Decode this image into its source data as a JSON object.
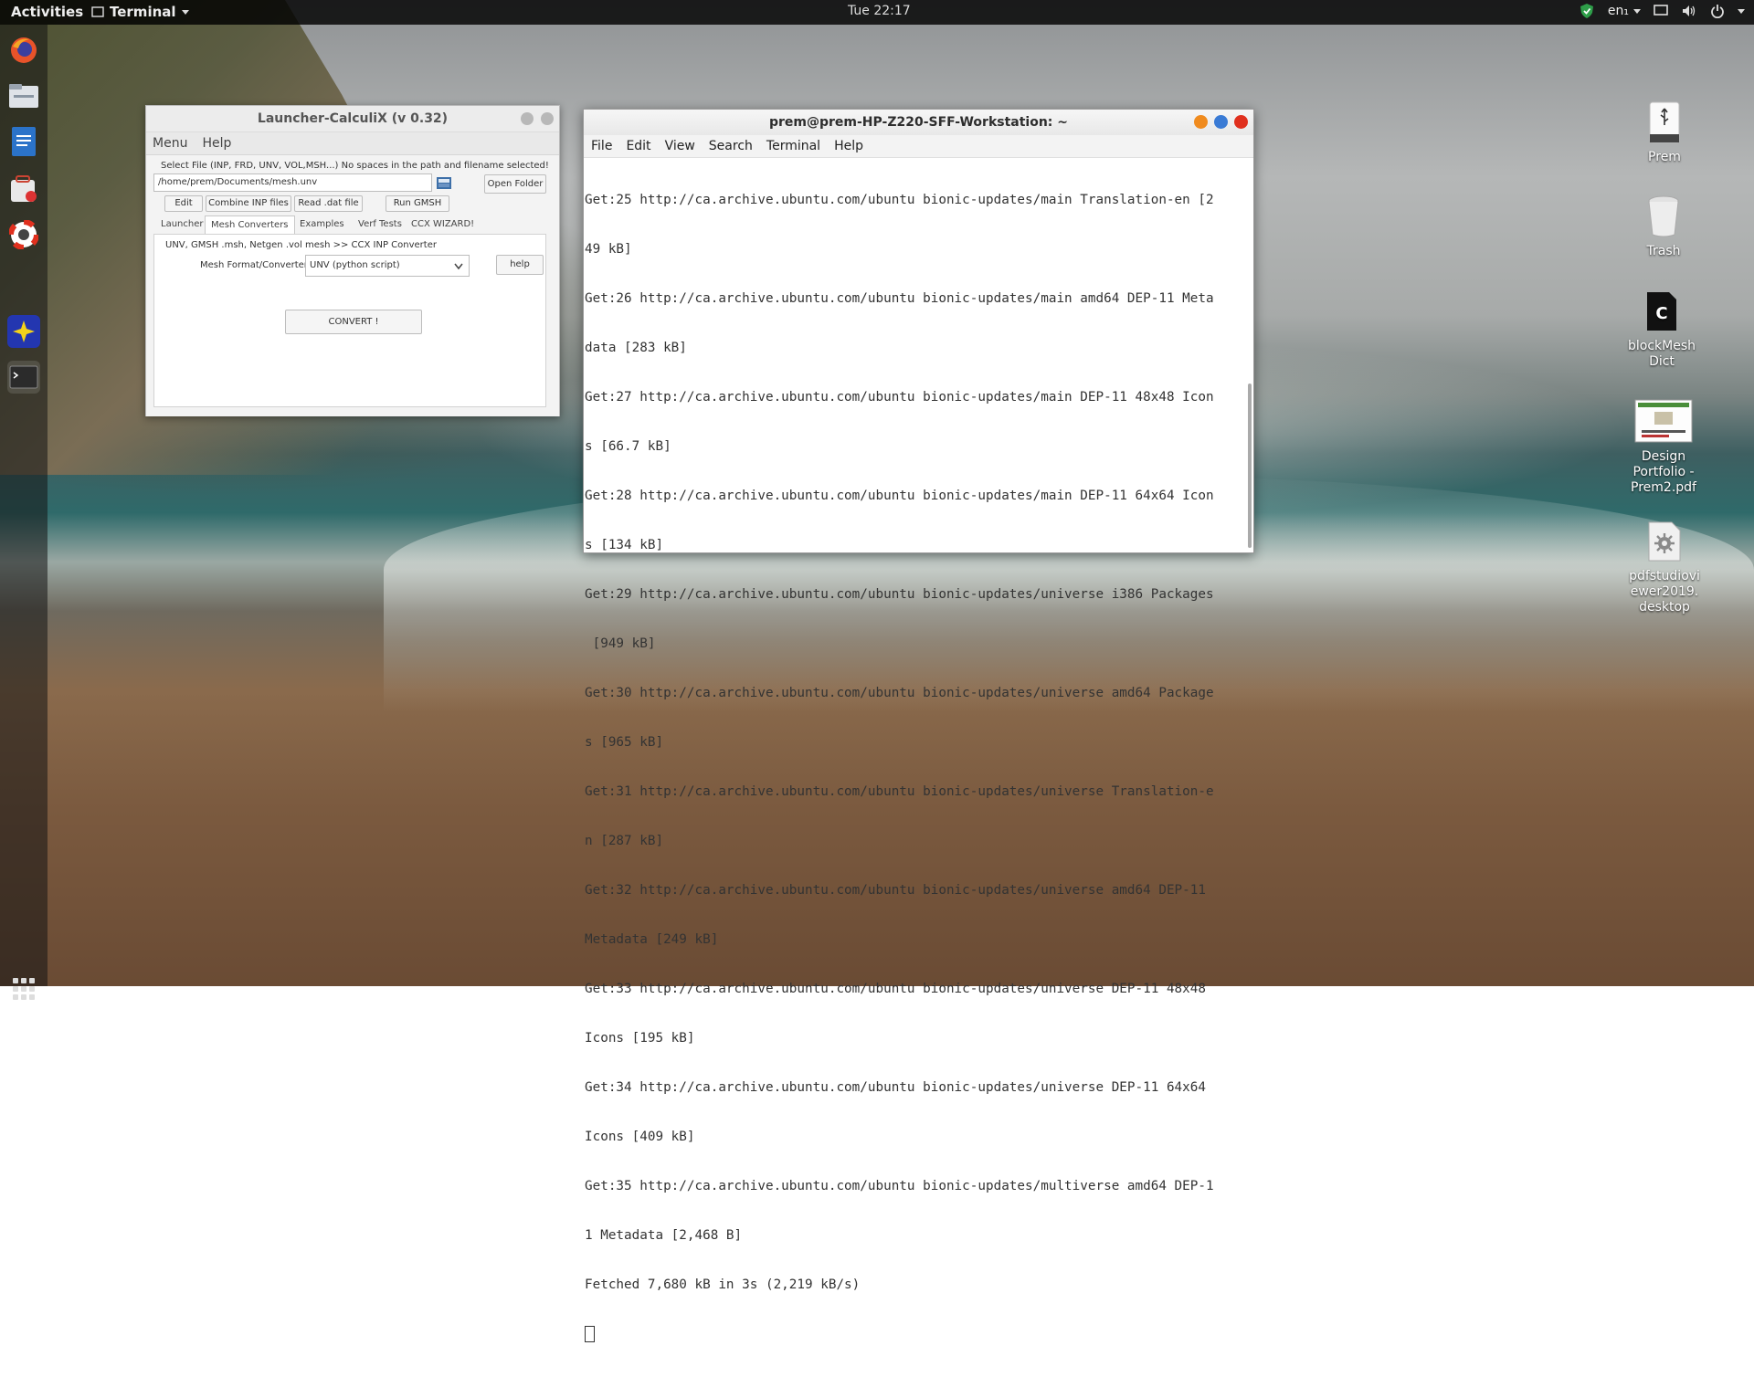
{
  "topbar": {
    "activities": "Activities",
    "app_menu": "Terminal",
    "clock": "Tue 22:17",
    "lang": "en₁"
  },
  "dock": {
    "items": [
      "firefox-icon",
      "files-icon",
      "writer-icon",
      "software-icon",
      "help-icon",
      "app-star-icon",
      "terminal-icon"
    ]
  },
  "desktop_icons": [
    {
      "label": "Prem",
      "icon": "usb-drive-icon"
    },
    {
      "label": "Trash",
      "icon": "trash-icon"
    },
    {
      "label": "blockMesh\nDict",
      "icon": "c-file-icon"
    },
    {
      "label": "Design\nPortfolio -\nPrem2.pdf",
      "icon": "pdf-thumbnail-icon"
    },
    {
      "label": "pdfstudiovi\newer2019.\ndesktop",
      "icon": "gear-file-icon"
    }
  ],
  "calculix": {
    "title": "Launcher-CalculiX (v 0.32)",
    "menu": [
      "Menu",
      "Help"
    ],
    "select_label": "Select File (INP, FRD, UNV, VOL,MSH...) No spaces in the path and filename selected!",
    "path_value": "/home/prem/Documents/mesh.unv",
    "open_folder": "Open Folder",
    "buttons": [
      "Edit",
      "Combine INP files",
      "Read .dat file",
      "Run GMSH"
    ],
    "tabs": [
      "Launcher",
      "Mesh Converters",
      "Examples",
      "Verf Tests",
      "CCX WIZARD!"
    ],
    "panel_heading": "UNV, GMSH .msh, Netgen .vol mesh >> CCX INP Converter",
    "format_label": "Mesh Format/Converter",
    "format_value": "UNV (python script)",
    "help": "help",
    "convert": "CONVERT !"
  },
  "terminal": {
    "title": "prem@prem-HP-Z220-SFF-Workstation: ~",
    "menu": [
      "File",
      "Edit",
      "View",
      "Search",
      "Terminal",
      "Help"
    ],
    "lines": [
      "Get:25 http://ca.archive.ubuntu.com/ubuntu bionic-updates/main Translation-en [2",
      "49 kB]",
      "Get:26 http://ca.archive.ubuntu.com/ubuntu bionic-updates/main amd64 DEP-11 Meta",
      "data [283 kB]",
      "Get:27 http://ca.archive.ubuntu.com/ubuntu bionic-updates/main DEP-11 48x48 Icon",
      "s [66.7 kB]",
      "Get:28 http://ca.archive.ubuntu.com/ubuntu bionic-updates/main DEP-11 64x64 Icon",
      "s [134 kB]",
      "Get:29 http://ca.archive.ubuntu.com/ubuntu bionic-updates/universe i386 Packages",
      " [949 kB]",
      "Get:30 http://ca.archive.ubuntu.com/ubuntu bionic-updates/universe amd64 Package",
      "s [965 kB]",
      "Get:31 http://ca.archive.ubuntu.com/ubuntu bionic-updates/universe Translation-e",
      "n [287 kB]",
      "Get:32 http://ca.archive.ubuntu.com/ubuntu bionic-updates/universe amd64 DEP-11",
      "Metadata [249 kB]",
      "Get:33 http://ca.archive.ubuntu.com/ubuntu bionic-updates/universe DEP-11 48x48",
      "Icons [195 kB]",
      "Get:34 http://ca.archive.ubuntu.com/ubuntu bionic-updates/universe DEP-11 64x64",
      "Icons [409 kB]",
      "Get:35 http://ca.archive.ubuntu.com/ubuntu bionic-updates/multiverse amd64 DEP-1",
      "1 Metadata [2,468 B]",
      "Fetched 7,680 kB in 3s (2,219 kB/s)"
    ]
  },
  "colors": {
    "close": "#e0301e",
    "maximize": "#3a7bd5",
    "minimize": "#f08b1e"
  }
}
